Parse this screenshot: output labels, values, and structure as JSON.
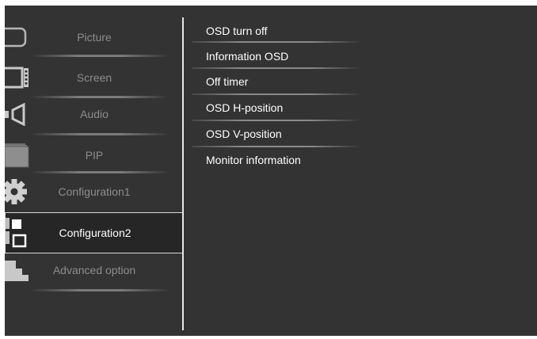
{
  "main_menu": {
    "items": [
      {
        "label": "Picture",
        "icon": "tv-screen-icon",
        "selected": false
      },
      {
        "label": "Screen",
        "icon": "film-screen-icon",
        "selected": false
      },
      {
        "label": "Audio",
        "icon": "speaker-icon",
        "selected": false
      },
      {
        "label": "PIP",
        "icon": "pip-windows-icon",
        "selected": false
      },
      {
        "label": "Configuration1",
        "icon": "gear-icon",
        "selected": false
      },
      {
        "label": "Configuration2",
        "icon": "config2-squares-icon",
        "selected": true
      },
      {
        "label": "Advanced option",
        "icon": "steps-icon",
        "selected": false
      }
    ]
  },
  "sub_menu": {
    "items": [
      {
        "label": "OSD turn off"
      },
      {
        "label": "Information OSD"
      },
      {
        "label": "Off timer"
      },
      {
        "label": "OSD H-position"
      },
      {
        "label": "OSD V-position"
      },
      {
        "label": "Monitor information"
      }
    ]
  },
  "colors": {
    "background": "#333333",
    "text_active": "#ffffff",
    "text_inactive": "#8d8d8d",
    "selection_border": "#d8d8d8"
  }
}
